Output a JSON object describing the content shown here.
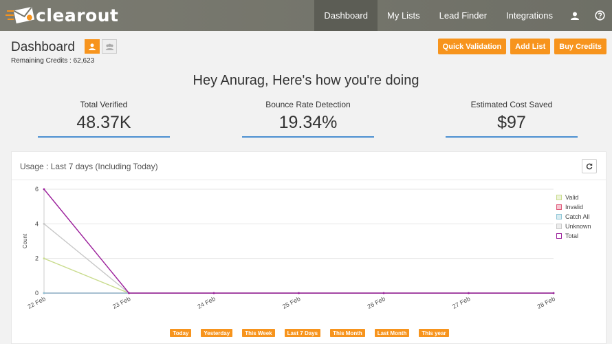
{
  "brand": {
    "name": "clearout",
    "accent": "#f7941d",
    "nav_bg": "#75766d"
  },
  "nav": {
    "items": [
      {
        "label": "Dashboard",
        "active": true
      },
      {
        "label": "My Lists"
      },
      {
        "label": "Lead Finder"
      },
      {
        "label": "Integrations"
      }
    ],
    "user_icon": "user-icon",
    "help_icon": "help-icon"
  },
  "header": {
    "title": "Dashboard",
    "credits_label": "Remaining Credits : 62,623"
  },
  "actions": {
    "quick_validation": "Quick Validation",
    "add_list": "Add List",
    "buy_credits": "Buy Credits"
  },
  "greeting": "Hey Anurag, Here's how you're doing",
  "stats": [
    {
      "label": "Total Verified",
      "value": "48.37K"
    },
    {
      "label": "Bounce Rate Detection",
      "value": "19.34%"
    },
    {
      "label": "Estimated Cost Saved",
      "value": "$97"
    }
  ],
  "usage": {
    "title_prefix": "Usage :",
    "title_range": "Last 7 days (Including Today)",
    "refresh_icon": "refresh-icon"
  },
  "chart_data": {
    "type": "line",
    "x": [
      "22 Feb",
      "23 Feb",
      "24 Feb",
      "25 Feb",
      "26 Feb",
      "27 Feb",
      "28 Feb"
    ],
    "ylabel": "Count",
    "xlabel": "",
    "ylim": [
      0,
      6
    ],
    "yticks": [
      0,
      2,
      4,
      6
    ],
    "grid": true,
    "legend_position": "right",
    "series": [
      {
        "name": "Valid",
        "color": "#c9dc8d",
        "values": [
          2,
          0,
          0,
          0,
          0,
          0,
          0
        ]
      },
      {
        "name": "Invalid",
        "color": "#e05a7a",
        "values": [
          0,
          0,
          0,
          0,
          0,
          0,
          0
        ]
      },
      {
        "name": "Catch All",
        "color": "#8ec5d6",
        "values": [
          0,
          0,
          0,
          0,
          0,
          0,
          0
        ]
      },
      {
        "name": "Unknown",
        "color": "#c8c8c8",
        "values": [
          4,
          0,
          0,
          0,
          0,
          0,
          0
        ]
      },
      {
        "name": "Total",
        "color": "#9b1f9b",
        "values": [
          6,
          0,
          0,
          0,
          0,
          0,
          0
        ]
      }
    ]
  },
  "ranges": [
    "Today",
    "Yesterday",
    "This Week",
    "Last 7 Days",
    "This Month",
    "Last Month",
    "This year"
  ]
}
